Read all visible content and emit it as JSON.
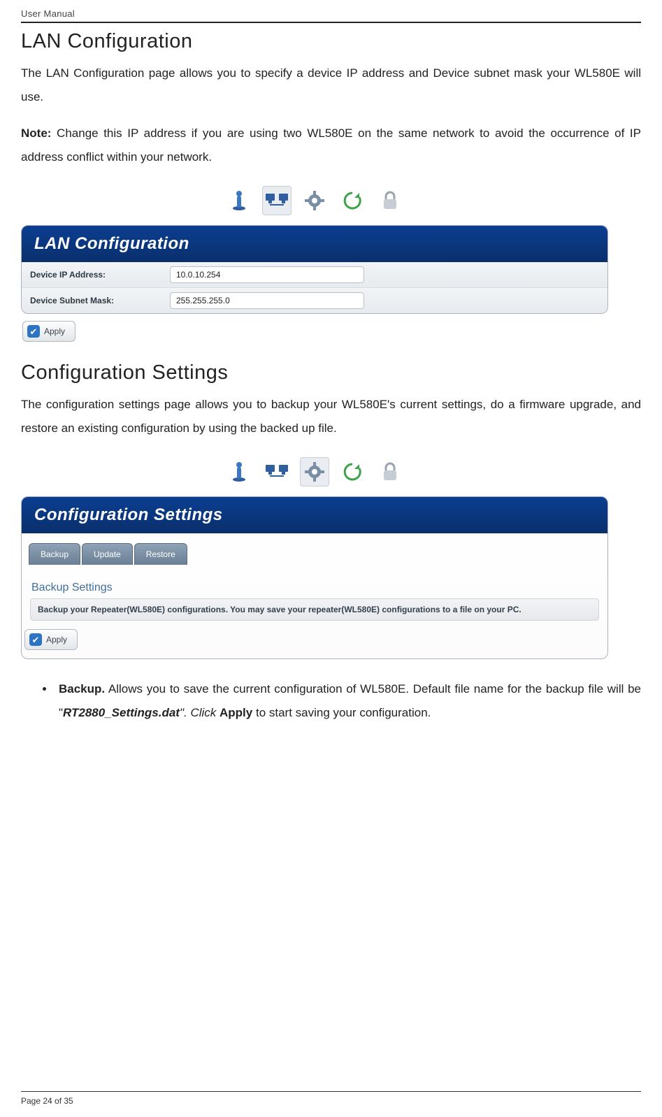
{
  "header": {
    "running": "User Manual"
  },
  "section1": {
    "heading": "LAN Configuration",
    "p1": "The LAN Configuration page allows you to specify a device IP address and Device subnet mask your WL580E will use.",
    "note_label": "Note:",
    "note_body": " Change this IP address if you are using two WL580E on the same network to avoid the occurrence of IP address conflict within your network."
  },
  "fig1": {
    "title": "LAN Configuration",
    "rows": [
      {
        "label": "Device IP Address:",
        "value": "10.0.10.254"
      },
      {
        "label": "Device Subnet Mask:",
        "value": "255.255.255.0"
      }
    ],
    "apply": "Apply"
  },
  "section2": {
    "heading": "Configuration Settings",
    "p1": "The configuration settings page allows you to backup your WL580E's current settings, do a firmware upgrade, and restore an existing configuration by using the backed up file."
  },
  "fig2": {
    "title": "Configuration Settings",
    "tabs": [
      "Backup",
      "Update",
      "Restore"
    ],
    "sub": "Backup Settings",
    "info": "Backup your Repeater(WL580E) configurations. You may save your repeater(WL580E) configurations to a file on your PC.",
    "apply": "Apply"
  },
  "bullets": {
    "backup_label": "Backup.",
    "backup_text_a": " Allows you to save the current configuration of WL580E. Default file name for the backup file will be \"",
    "backup_filename": "RT2880_Settings.dat",
    "backup_text_b": "\". Click ",
    "backup_apply": "Apply",
    "backup_text_c": " to start saving your configuration."
  },
  "footer": {
    "page": "Page 24 of 35"
  }
}
